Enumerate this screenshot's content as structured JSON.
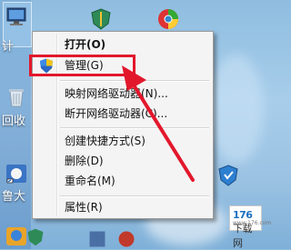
{
  "desktop": {
    "label_top": "计",
    "label_mid": "回收",
    "label_bottom": "鲁大"
  },
  "context_menu": {
    "items": [
      {
        "label": "打开(O)"
      },
      {
        "label": "管理(G)"
      },
      {
        "label": "映射网络驱动器(N)..."
      },
      {
        "label": "断开网络驱动器(C)..."
      },
      {
        "label": "创建快捷方式(S)"
      },
      {
        "label": "删除(D)"
      },
      {
        "label": "重命名(M)"
      },
      {
        "label": "属性(R)"
      }
    ]
  },
  "highlight_color": "#e3172c",
  "watermark": {
    "text": "176",
    "suffix": "下载网",
    "sub": "www.176.com"
  }
}
